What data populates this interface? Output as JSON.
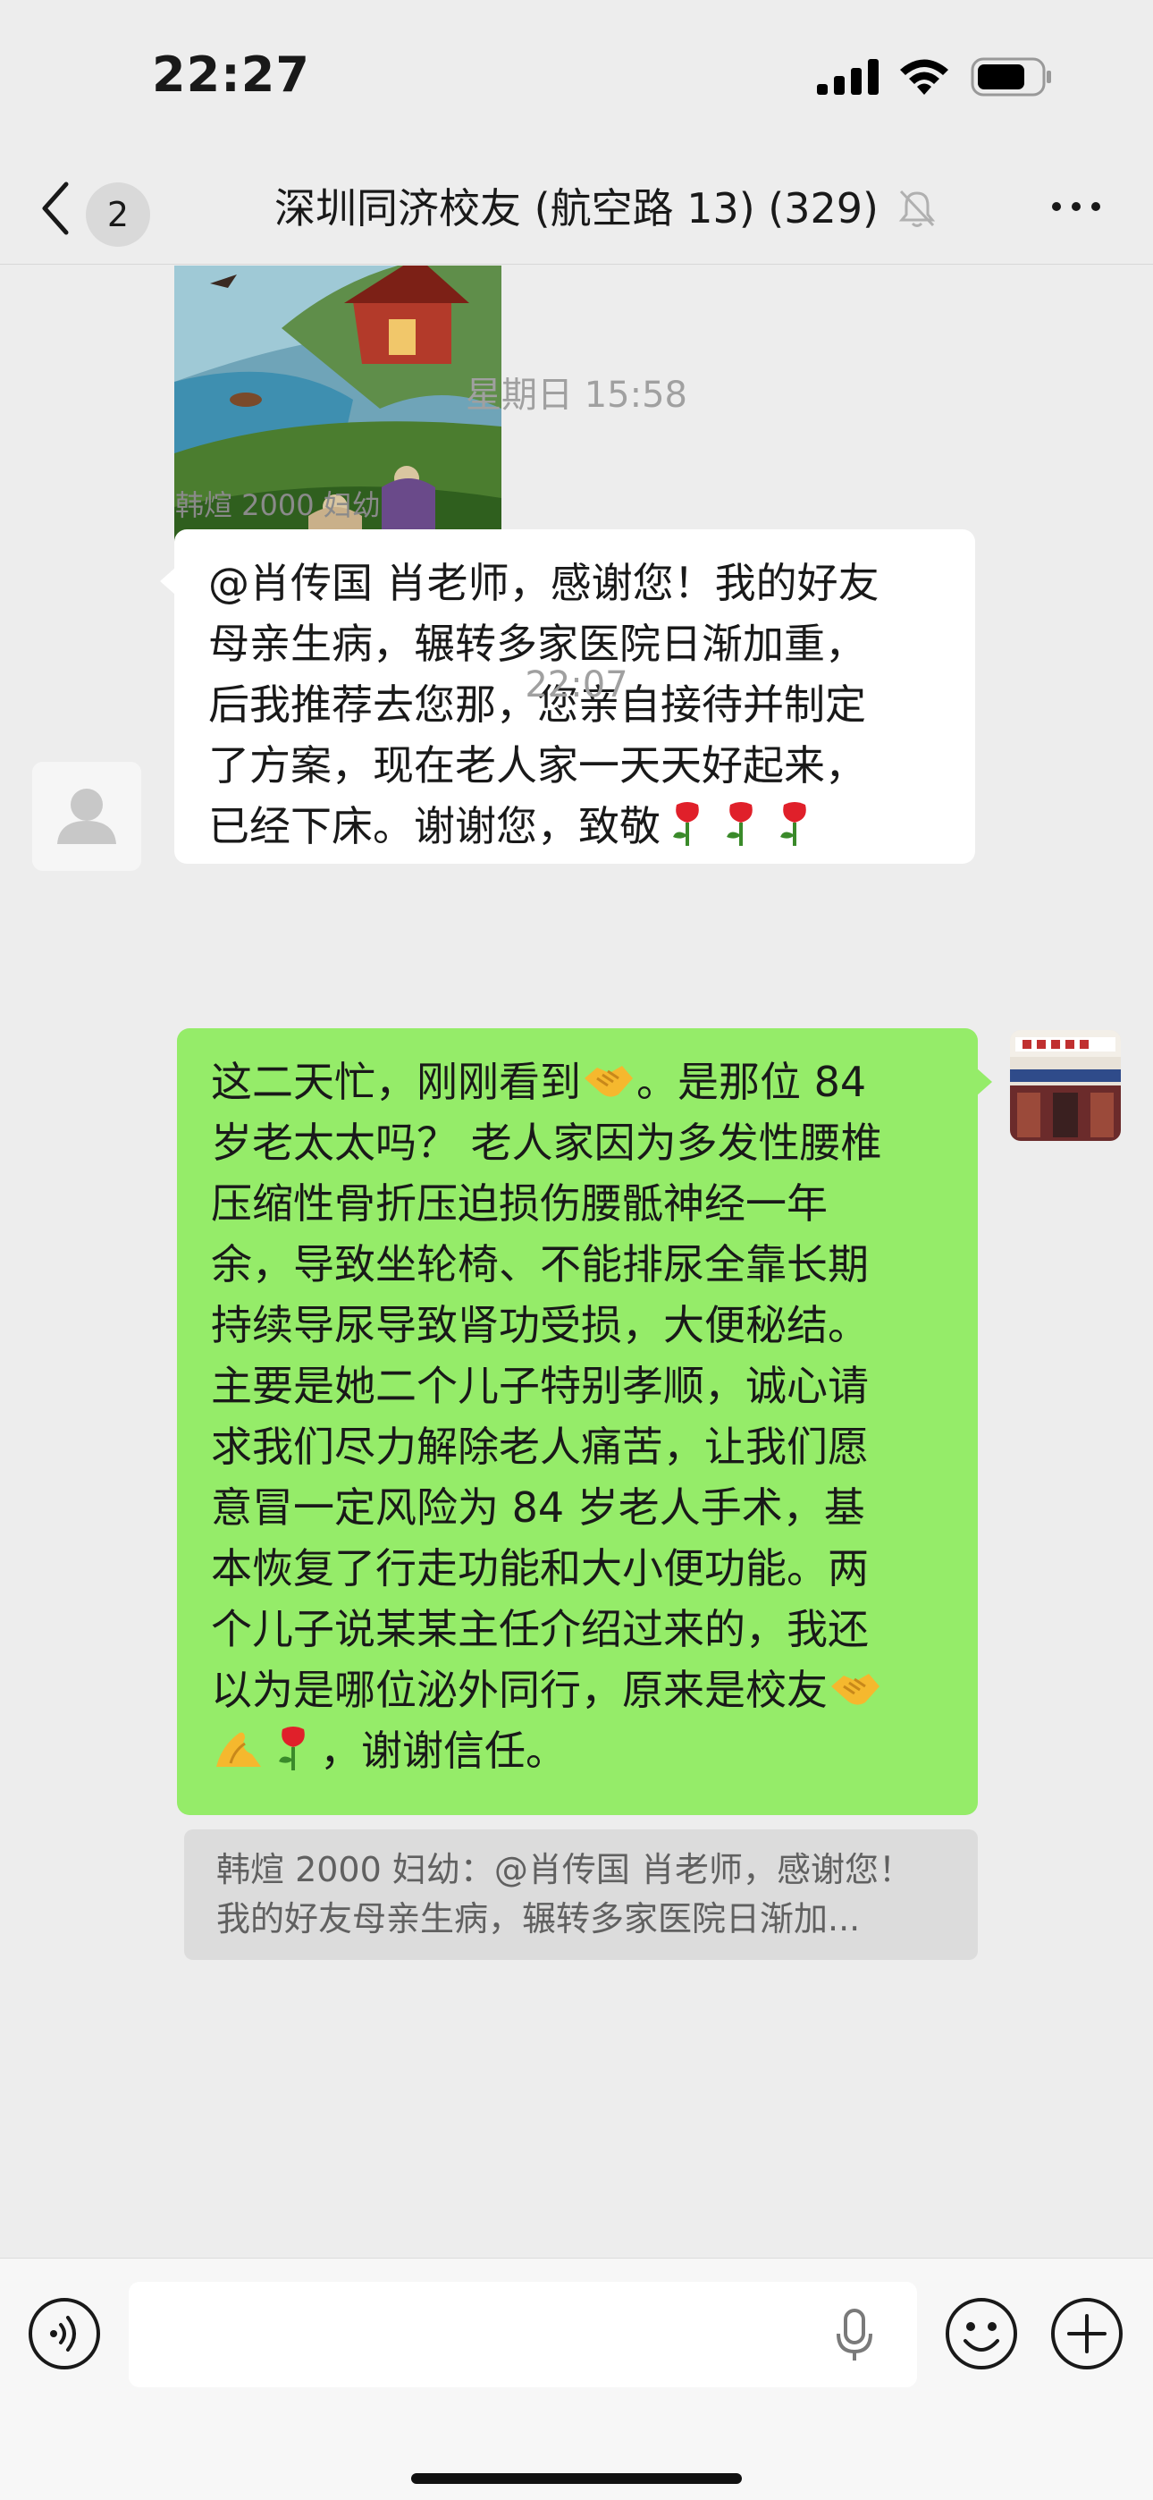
{
  "status_bar": {
    "time": "22:27"
  },
  "nav": {
    "unread_count": "2",
    "title": "深圳同济校友 (航空路 13) (329)",
    "icons": [
      "back-icon",
      "mute-icon",
      "more-icon"
    ]
  },
  "messages": [
    {
      "type": "image",
      "side": "left"
    },
    {
      "type": "time",
      "text": "星期日 15:58"
    },
    {
      "type": "text",
      "side": "left",
      "sender": "韩煊 2000 妇幼",
      "lines": [
        "@肖传国 肖老师，感谢您！我的好友",
        "母亲生病，辗转多家医院日渐加重，",
        "后我推荐去您那，您亲自接待并制定",
        "了方案，现在老人家一天天好起来，",
        "已经下床。谢谢您，致敬"
      ]
    },
    {
      "type": "time",
      "text": "22:07"
    },
    {
      "type": "text",
      "side": "right",
      "lines": [
        "这二天忙，刚刚看到",
        "。是那位 84",
        "岁老太太吗？ 老人家因为多发性腰椎",
        "压缩性骨折压迫损伤腰骶神经一年",
        "余，导致坐轮椅、不能排尿全靠长期",
        "持续导尿导致肾功受损，大便秘结。",
        "主要是她二个儿子特别孝顺，诚心请",
        "求我们尽力解除老人痛苦，让我们愿",
        "意冒一定风险为 84 岁老人手术，基",
        "本恢复了行走功能和大小便功能。两",
        "个儿子说某某主任介绍过来的，我还",
        "以为是哪位泌外同行，原来是校友",
        "，谢谢信任。"
      ],
      "quote": {
        "line1": "韩煊 2000 妇幼：@肖传国 肖老师，感谢您！",
        "line2": "我的好友母亲生病，辗转多家医院日渐加..."
      }
    }
  ],
  "colors": {
    "background": "#ededed",
    "bubble_self": "#95ec69",
    "bubble_other": "#ffffff",
    "quote_bg": "#dcdcdc"
  }
}
